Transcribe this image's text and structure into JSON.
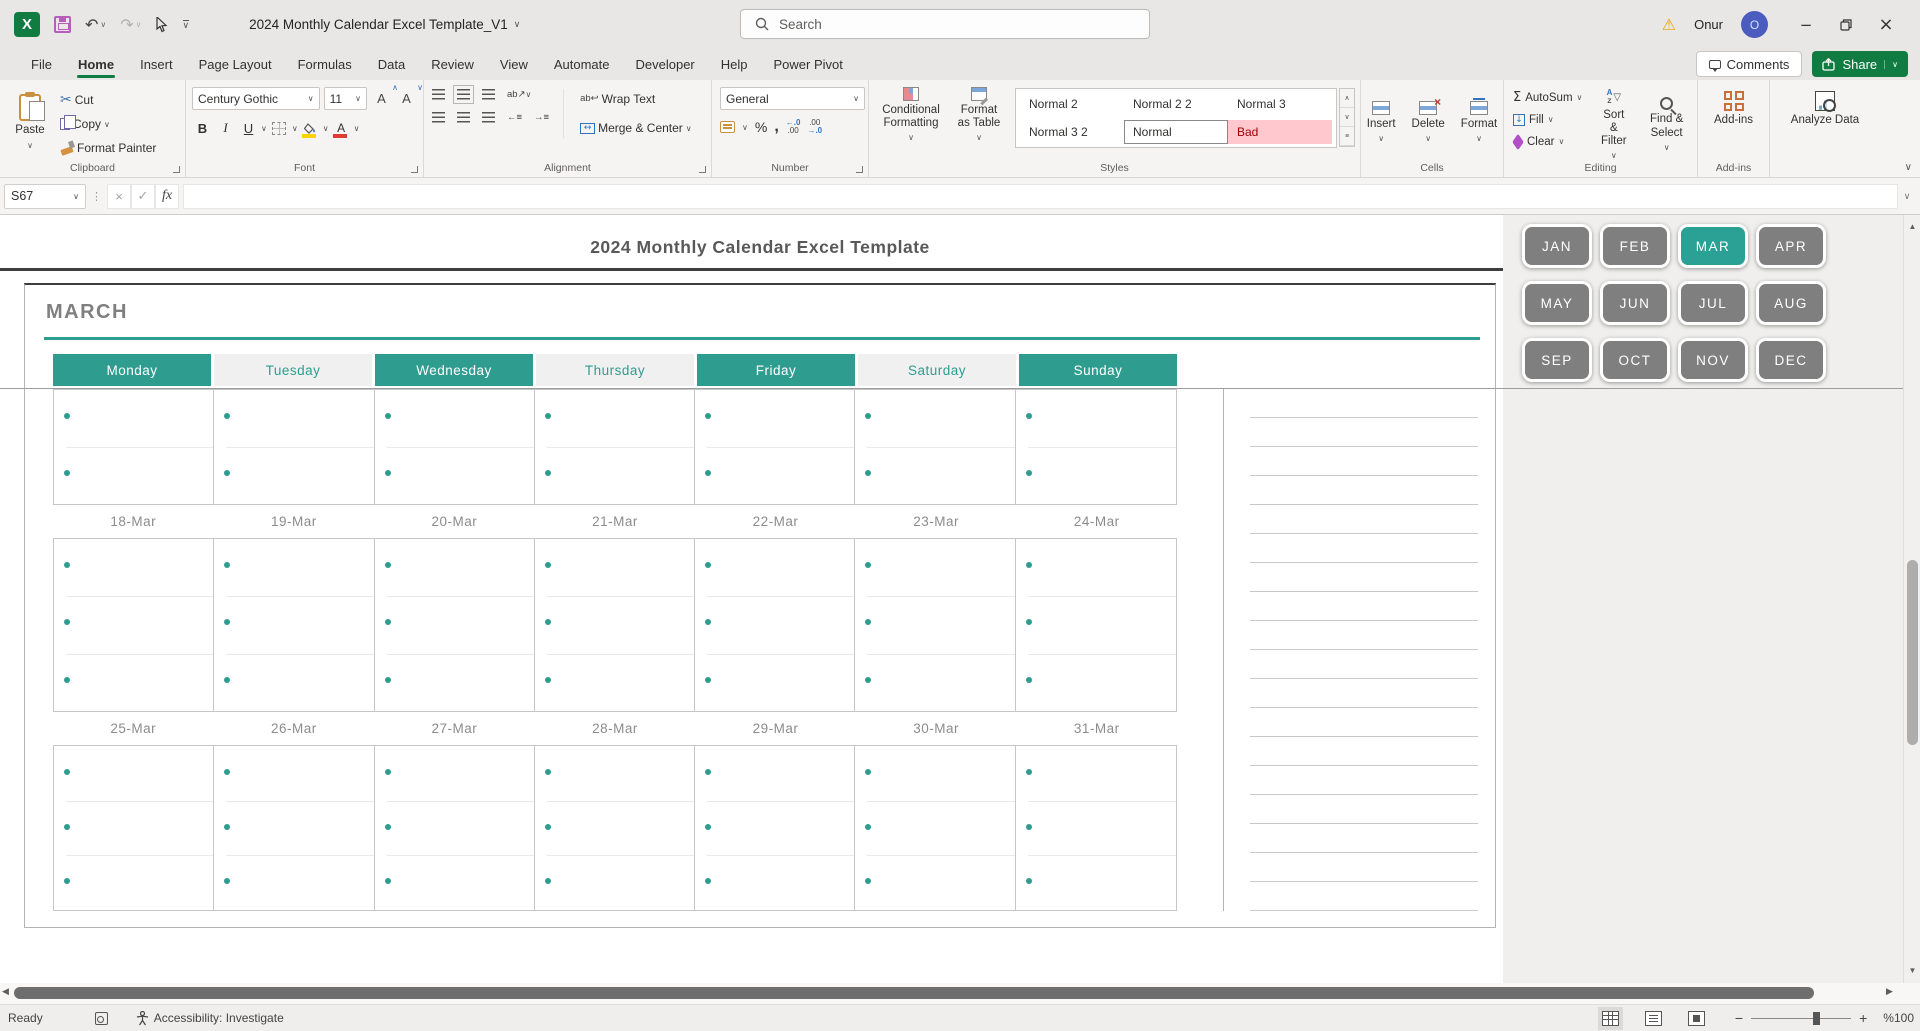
{
  "title_bar": {
    "document_title": "2024 Monthly Calendar Excel Template_V1",
    "search_placeholder": "Search",
    "user_name": "Onur",
    "avatar_initial": "O",
    "window_controls": {
      "minimize": "−",
      "restore": "❏",
      "close": "×"
    }
  },
  "ribbon": {
    "tabs": [
      {
        "label": "File",
        "active": false
      },
      {
        "label": "Home",
        "active": true
      },
      {
        "label": "Insert",
        "active": false
      },
      {
        "label": "Page Layout",
        "active": false
      },
      {
        "label": "Formulas",
        "active": false
      },
      {
        "label": "Data",
        "active": false
      },
      {
        "label": "Review",
        "active": false
      },
      {
        "label": "View",
        "active": false
      },
      {
        "label": "Automate",
        "active": false
      },
      {
        "label": "Developer",
        "active": false
      },
      {
        "label": "Help",
        "active": false
      },
      {
        "label": "Power Pivot",
        "active": false
      }
    ],
    "comments_label": "Comments",
    "share_label": "Share",
    "clipboard": {
      "group_label": "Clipboard",
      "paste": "Paste",
      "cut": "Cut",
      "copy": "Copy",
      "format_painter": "Format Painter"
    },
    "font": {
      "group_label": "Font",
      "font_name": "Century Gothic",
      "font_size": "11",
      "bold": "B",
      "italic": "I",
      "underline": "U"
    },
    "alignment": {
      "group_label": "Alignment",
      "wrap_text": "Wrap Text",
      "merge_center": "Merge & Center",
      "orientation": "ab"
    },
    "number": {
      "group_label": "Number",
      "format": "General",
      "percent": "%",
      "comma": ",",
      "inc_dec": "←.0\n.00",
      "dec_dec": ".00\n→.0"
    },
    "styles": {
      "group_label": "Styles",
      "conditional_formatting": "Conditional Formatting",
      "format_as_table": "Format as Table",
      "gallery": [
        {
          "label": "Normal 2",
          "variant": "plain"
        },
        {
          "label": "Normal 2 2",
          "variant": "plain"
        },
        {
          "label": "Normal 3",
          "variant": "plain"
        },
        {
          "label": "Normal 3 2",
          "variant": "plain"
        },
        {
          "label": "Normal",
          "variant": "selected"
        },
        {
          "label": "Bad",
          "variant": "bad"
        }
      ]
    },
    "cells": {
      "group_label": "Cells",
      "insert": "Insert",
      "delete": "Delete",
      "format": "Format"
    },
    "editing": {
      "group_label": "Editing",
      "autosum": "AutoSum",
      "fill": "Fill",
      "clear": "Clear",
      "sort_filter": "Sort & Filter",
      "find_select": "Find & Select"
    },
    "addins": {
      "group_label": "Add-ins",
      "addins_button": "Add-ins"
    },
    "analyze": {
      "analyze_button": "Analyze Data"
    }
  },
  "formula_bar": {
    "name_box": "S67",
    "fx_label": "fx",
    "formula_value": ""
  },
  "sheet": {
    "workbook_title": "2024 Monthly Calendar Excel Template",
    "month_title": "MARCH",
    "weekdays": [
      {
        "label": "Monday",
        "accent": true
      },
      {
        "label": "Tuesday",
        "accent": false
      },
      {
        "label": "Wednesday",
        "accent": true
      },
      {
        "label": "Thursday",
        "accent": false
      },
      {
        "label": "Friday",
        "accent": true
      },
      {
        "label": "Saturday",
        "accent": false
      },
      {
        "label": "Sunday",
        "accent": true
      }
    ],
    "week2_dates": [
      "18-Mar",
      "19-Mar",
      "20-Mar",
      "21-Mar",
      "22-Mar",
      "23-Mar",
      "24-Mar"
    ],
    "week3_dates": [
      "25-Mar",
      "26-Mar",
      "27-Mar",
      "28-Mar",
      "29-Mar",
      "30-Mar",
      "31-Mar"
    ],
    "calendar_blocks": [
      {
        "rows": 2,
        "cells": 14
      },
      {
        "rows": 3,
        "cells": 21
      },
      {
        "rows": 3,
        "cells": 21
      }
    ],
    "month_buttons": [
      {
        "label": "JAN",
        "active": false
      },
      {
        "label": "FEB",
        "active": false
      },
      {
        "label": "MAR",
        "active": true
      },
      {
        "label": "APR",
        "active": false
      },
      {
        "label": "MAY",
        "active": false
      },
      {
        "label": "JUN",
        "active": false
      },
      {
        "label": "JUL",
        "active": false
      },
      {
        "label": "AUG",
        "active": false
      },
      {
        "label": "SEP",
        "active": false
      },
      {
        "label": "OCT",
        "active": false
      },
      {
        "label": "NOV",
        "active": false
      },
      {
        "label": "DEC",
        "active": false
      }
    ],
    "colors": {
      "teal_accent": "#2e9d90",
      "month_button_gray": "#7f7f7f",
      "active_month_teal": "#2aa194",
      "bad_style_bg": "#ffc7ce",
      "bad_style_text": "#9c0006",
      "share_green": "#107c41",
      "avatar_blue": "#4b5bbe"
    }
  },
  "status_bar": {
    "mode": "Ready",
    "accessibility": "Accessibility: Investigate",
    "zoom_level": "%100"
  }
}
